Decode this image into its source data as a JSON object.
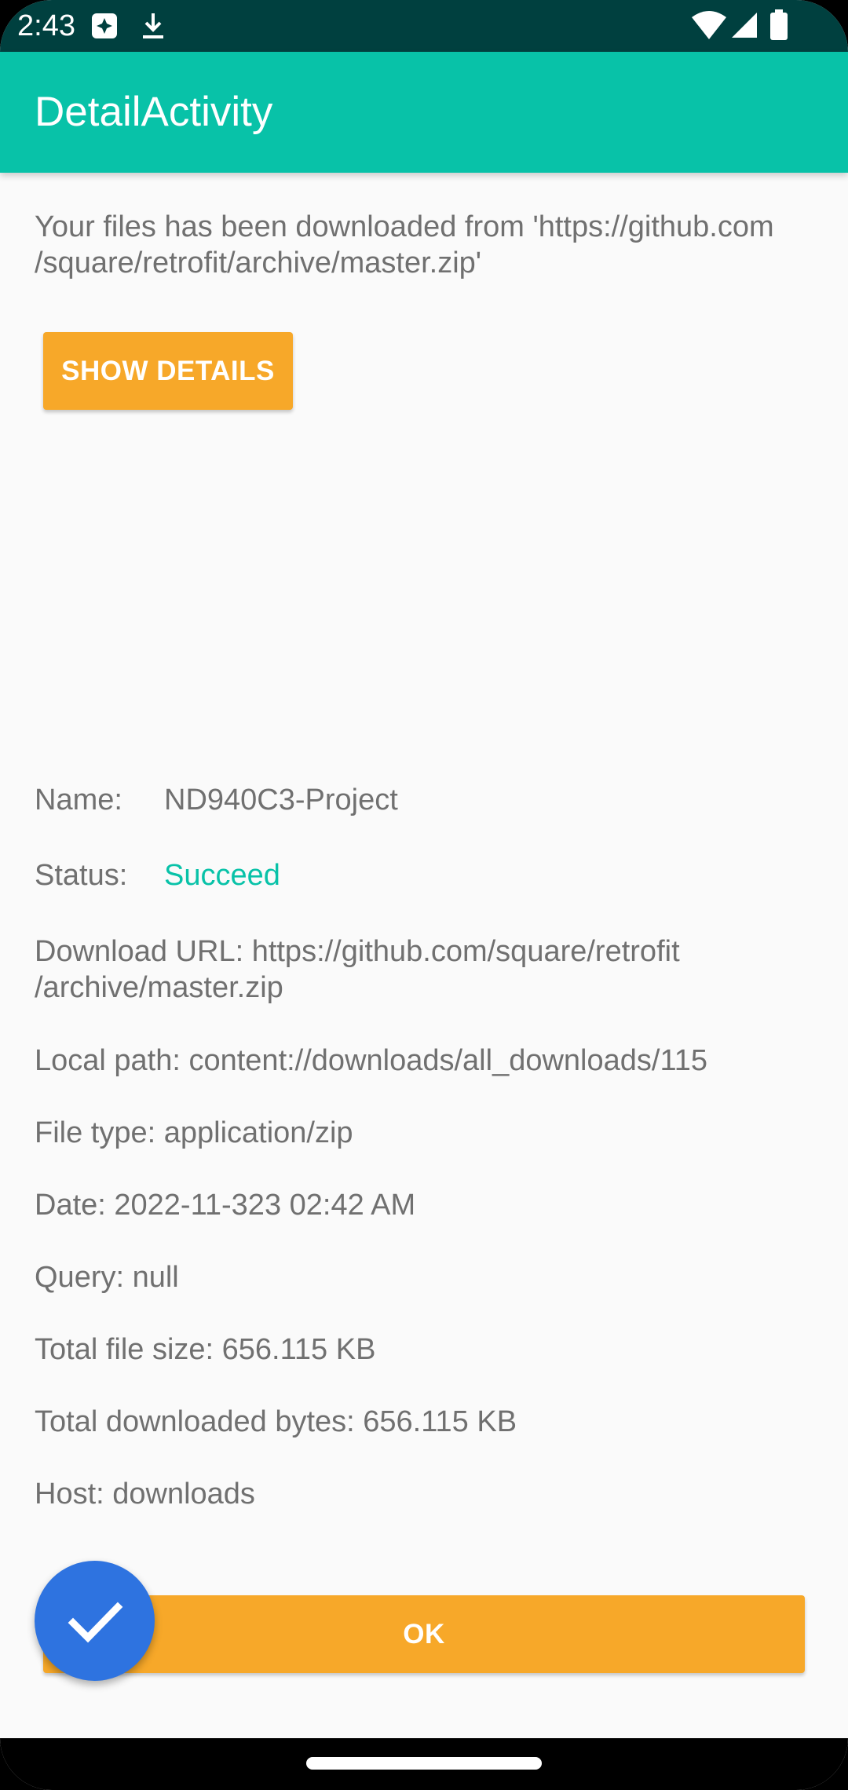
{
  "status_bar": {
    "time": "2:43",
    "left_icons": [
      "notification-icon",
      "download-icon"
    ],
    "right_icons": [
      "wifi-icon",
      "signal-icon",
      "battery-icon"
    ]
  },
  "app_bar": {
    "title": "DetailActivity"
  },
  "intro_text": "Your files has been downloaded from 'https://github.com /square/retrofit/archive/master.zip'",
  "show_details_button": "SHOW DETAILS",
  "details": {
    "name_label": "Name:",
    "name_value": "ND940C3-Project",
    "status_label": "Status:",
    "status_value": "Succeed",
    "download_url": "Download URL: https://github.com/square/retrofit /archive/master.zip",
    "local_path": "Local path: content://downloads/all_downloads/115",
    "file_type": "File type: application/zip",
    "date": "Date: 2022-11-323 02:42 AM",
    "query": "Query: null",
    "total_file_size": "Total file size: 656.115 KB",
    "total_downloaded": "Total downloaded bytes: 656.115 KB",
    "host": "Host: downloads"
  },
  "ok_button": "OK",
  "fab_icon": "check-icon",
  "colors": {
    "status_bar": "#00403f",
    "app_bar": "#08c2a8",
    "accent_button": "#f7a829",
    "fab": "#2e73e0",
    "status_succeed": "#08c2a8"
  }
}
